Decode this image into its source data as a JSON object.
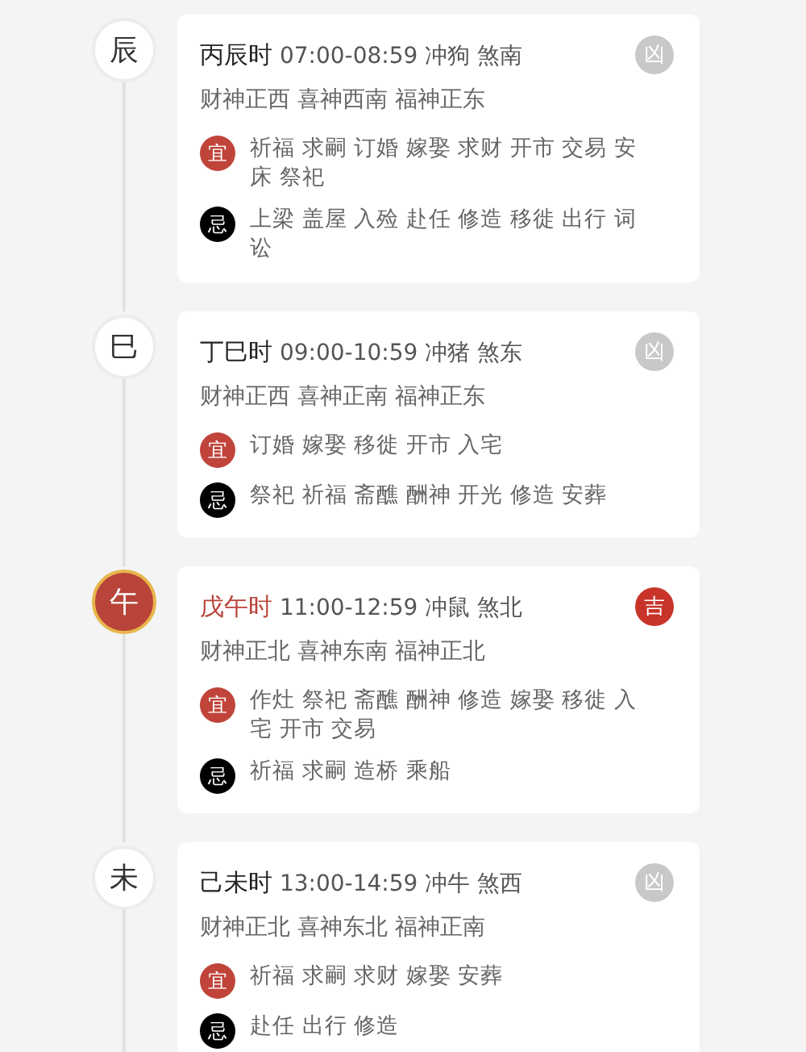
{
  "hours": [
    {
      "branch": "辰",
      "selected": false,
      "name": "丙辰时",
      "info": "07:00-08:59 冲狗 煞南",
      "gods": "财神正西 喜神西南 福神正东",
      "luck": {
        "label": "凶",
        "kind": "bad"
      },
      "yi": {
        "label": "宜",
        "text": "祈福 求嗣 订婚 嫁娶 求财 开市 交易 安床 祭祀"
      },
      "ji": {
        "label": "忌",
        "text": "上梁 盖屋 入殓 赴任 修造 移徙 出行 词讼"
      }
    },
    {
      "branch": "巳",
      "selected": false,
      "name": "丁巳时",
      "info": "09:00-10:59 冲猪 煞东",
      "gods": "财神正西 喜神正南 福神正东",
      "luck": {
        "label": "凶",
        "kind": "bad"
      },
      "yi": {
        "label": "宜",
        "text": "订婚 嫁娶 移徙 开市 入宅"
      },
      "ji": {
        "label": "忌",
        "text": "祭祀 祈福 斋醮 酬神 开光 修造 安葬"
      }
    },
    {
      "branch": "午",
      "selected": true,
      "name": "戊午时",
      "info": "11:00-12:59 冲鼠 煞北",
      "gods": "财神正北 喜神东南 福神正北",
      "luck": {
        "label": "吉",
        "kind": "good"
      },
      "yi": {
        "label": "宜",
        "text": "作灶 祭祀 斋醮 酬神 修造 嫁娶 移徙 入宅 开市 交易"
      },
      "ji": {
        "label": "忌",
        "text": "祈福 求嗣 造桥 乘船"
      }
    },
    {
      "branch": "未",
      "selected": false,
      "name": "己未时",
      "info": "13:00-14:59 冲牛 煞西",
      "gods": "财神正北 喜神东北 福神正南",
      "luck": {
        "label": "凶",
        "kind": "bad"
      },
      "yi": {
        "label": "宜",
        "text": "祈福 求嗣 求财 嫁娶 安葬"
      },
      "ji": {
        "label": "忌",
        "text": "赴任 出行 修造"
      }
    }
  ]
}
